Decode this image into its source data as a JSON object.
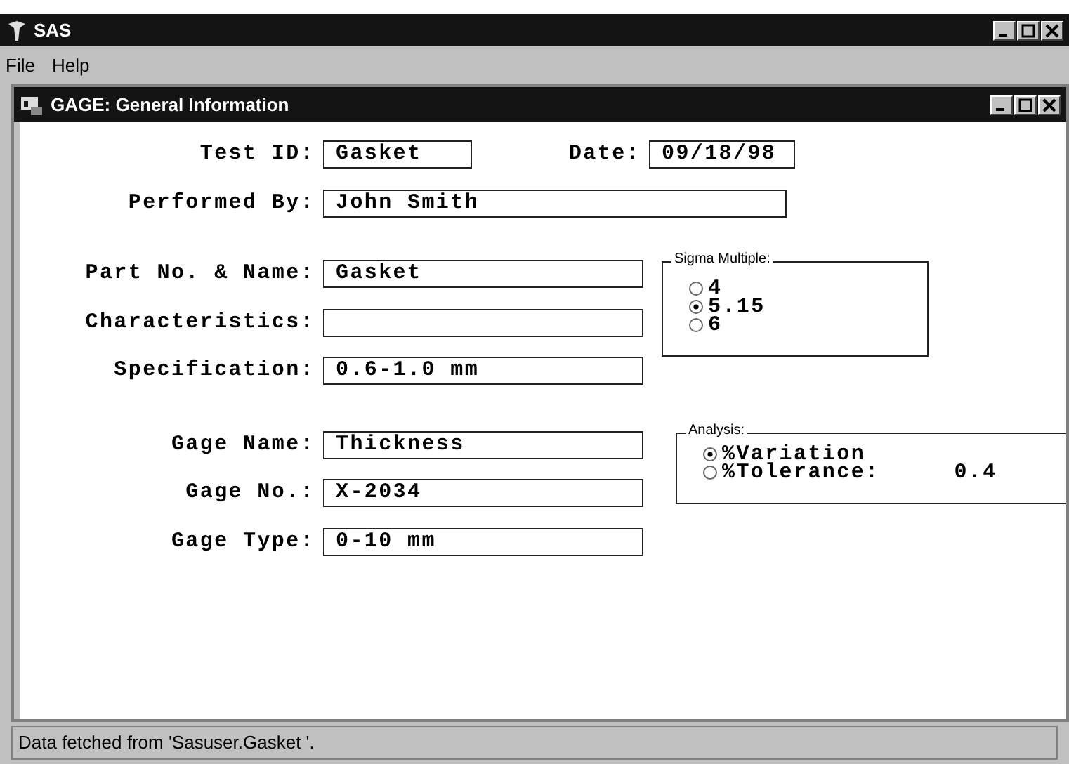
{
  "window": {
    "title": "SAS"
  },
  "menu": [
    "File",
    "Help"
  ],
  "dialog": {
    "title": "GAGE: General Information"
  },
  "test_row": [
    {
      "label": "Test ID:",
      "value": "Gasket"
    },
    {
      "label": "Date:",
      "value": "09/18/98"
    }
  ],
  "performed_by": {
    "label": "Performed By:",
    "value": "John Smith"
  },
  "part_fields": [
    {
      "label": "Part No. & Name:",
      "value": "Gasket"
    },
    {
      "label": "Characteristics:"
    },
    {
      "label": "Specification:",
      "value": "0.6-1.0 mm"
    }
  ],
  "gage_fields": [
    {
      "label": "Gage Name:",
      "value": "Thickness"
    },
    {
      "label": "Gage No.:",
      "value": "X-2034"
    },
    {
      "label": "Gage Type:",
      "value": "0-10 mm"
    }
  ],
  "sigma_multiple": {
    "title": "Sigma Multiple:",
    "options": [
      {
        "label": "4",
        "selected": false
      },
      {
        "label": "5.15",
        "selected": true
      },
      {
        "label": "6",
        "selected": false
      }
    ]
  },
  "analysis": {
    "title": "Analysis:",
    "options": [
      {
        "label": "%Variation",
        "selected": true
      },
      {
        "label": "%Tolerance:",
        "selected": false,
        "value": "0.4"
      }
    ]
  },
  "status_bar": "Data fetched from 'Sasuser.Gasket '."
}
